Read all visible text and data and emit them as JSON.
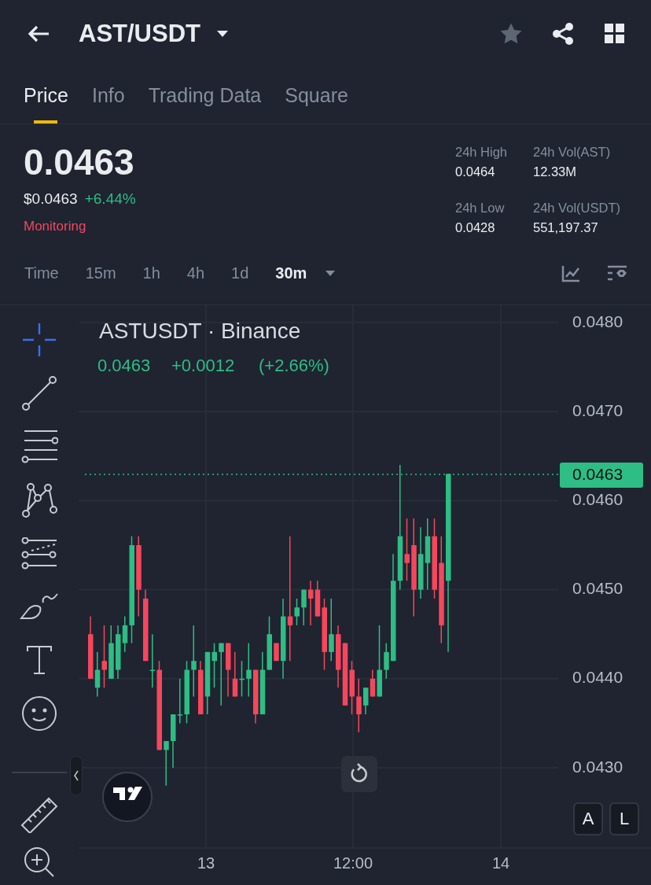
{
  "header": {
    "title": "AST/USDT",
    "favorite": false
  },
  "tabs": [
    {
      "label": "Price",
      "selected": true
    },
    {
      "label": "Info",
      "selected": false
    },
    {
      "label": "Trading Data",
      "selected": false
    },
    {
      "label": "Square",
      "selected": false
    }
  ],
  "price": {
    "last": "0.0463",
    "usd": "$0.0463",
    "change": "+6.44%",
    "status": "Monitoring"
  },
  "stats": [
    {
      "label": "24h High",
      "value": "0.0464"
    },
    {
      "label": "24h Vol(AST)",
      "value": "12.33M"
    },
    {
      "label": "24h Low",
      "value": "0.0428"
    },
    {
      "label": "24h Vol(USDT)",
      "value": "551,197.37"
    }
  ],
  "intervals": [
    {
      "label": "Time",
      "selected": false
    },
    {
      "label": "15m",
      "selected": false
    },
    {
      "label": "1h",
      "selected": false
    },
    {
      "label": "4h",
      "selected": false
    },
    {
      "label": "1d",
      "selected": false
    },
    {
      "label": "30m",
      "selected": true
    }
  ],
  "tools": [
    {
      "kind": "crosshair",
      "selected": true
    },
    {
      "kind": "trend-line",
      "selected": false
    },
    {
      "kind": "fib",
      "selected": false
    },
    {
      "kind": "pattern",
      "selected": false
    },
    {
      "kind": "forecast",
      "selected": false
    },
    {
      "kind": "brush",
      "selected": false
    },
    {
      "kind": "text",
      "selected": false
    },
    {
      "kind": "emoji",
      "selected": false
    },
    {
      "kind": "ruler",
      "selected": false
    },
    {
      "kind": "zoom",
      "selected": false
    }
  ],
  "chart": {
    "symbol": "ASTUSDT · Binance",
    "last": "0.0463",
    "change": "+0.0012",
    "change_pct": "(+2.66%)",
    "price_tag": "0.0463",
    "yticks": [
      "0.0480",
      "0.0470",
      "0.0460",
      "0.0450",
      "0.0440",
      "0.0430"
    ],
    "xticks": [
      "13",
      "12:00",
      "14"
    ],
    "scale_buttons": [
      "A",
      "L"
    ]
  }
}
